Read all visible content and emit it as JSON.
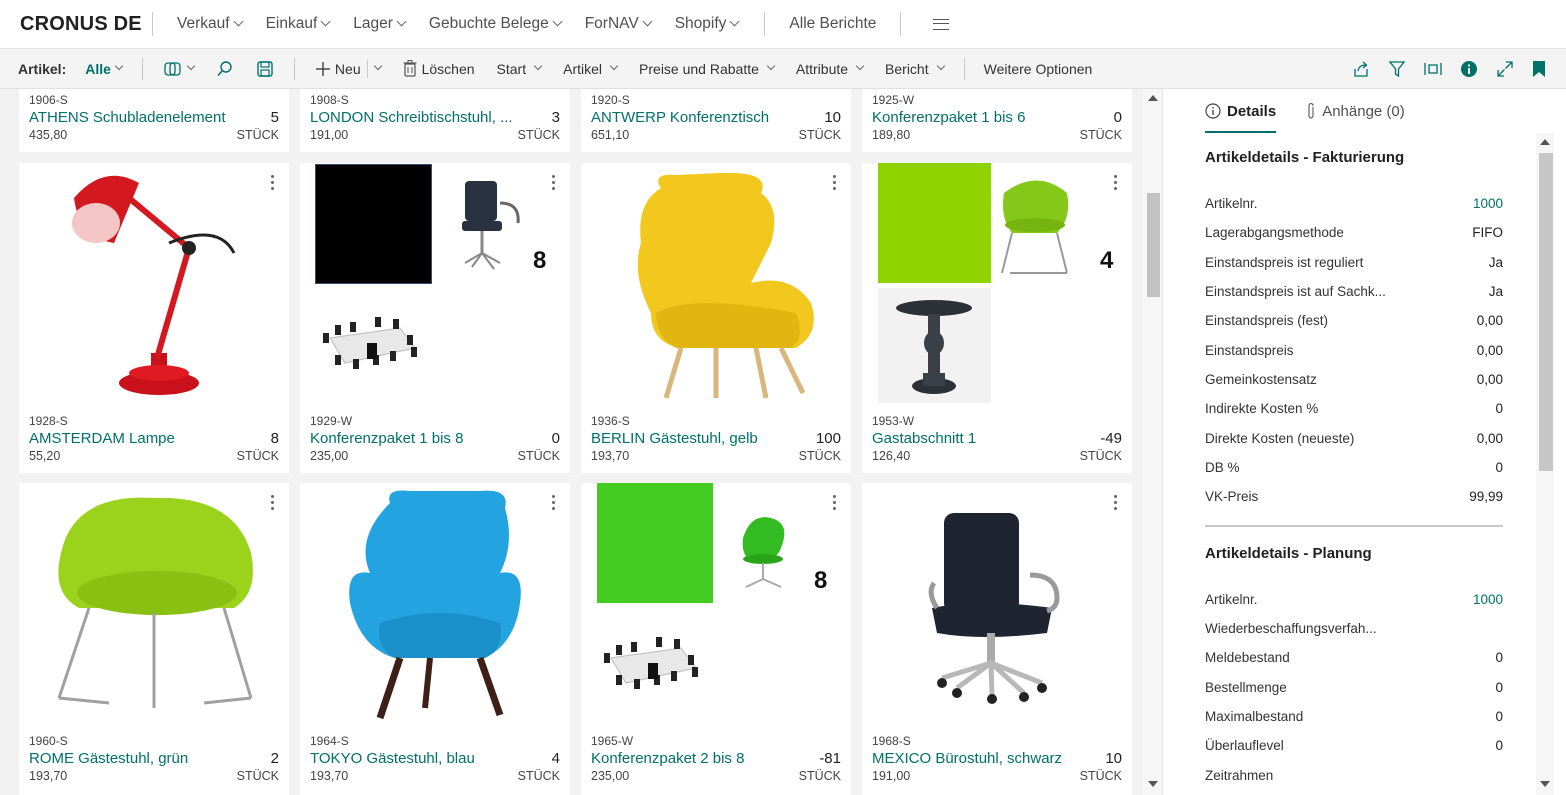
{
  "app": {
    "company": "CRONUS DE"
  },
  "nav": {
    "items": [
      "Verkauf",
      "Einkauf",
      "Lager",
      "Gebuchte Belege",
      "ForNAV",
      "Shopify"
    ],
    "reports": "Alle Berichte"
  },
  "actionbar": {
    "label": "Artikel:",
    "filter": "Alle",
    "new": "Neu",
    "delete": "Löschen",
    "start": "Start",
    "artikel": "Artikel",
    "prices": "Preise und Rabatte",
    "attributes": "Attribute",
    "report": "Bericht",
    "more": "Weitere Optionen"
  },
  "tiles": [
    {
      "code": "1906-S",
      "name": "ATHENS Schubladenelement",
      "qty": "5",
      "price": "435,80",
      "unit": "STÜCK"
    },
    {
      "code": "1908-S",
      "name": "LONDON Schreibtischstuhl, ...",
      "qty": "3",
      "price": "191,00",
      "unit": "STÜCK"
    },
    {
      "code": "1920-S",
      "name": "ANTWERP Konferenztisch",
      "qty": "10",
      "price": "651,10",
      "unit": "STÜCK"
    },
    {
      "code": "1925-W",
      "name": "Konferenzpaket 1 bis 6",
      "qty": "0",
      "price": "189,80",
      "unit": "STÜCK"
    },
    {
      "code": "1928-S",
      "name": "AMSTERDAM Lampe",
      "qty": "8",
      "price": "55,20",
      "unit": "STÜCK"
    },
    {
      "code": "1929-W",
      "name": "Konferenzpaket 1 bis 8",
      "qty": "0",
      "price": "235,00",
      "unit": "STÜCK",
      "badge": "8"
    },
    {
      "code": "1936-S",
      "name": "BERLIN Gästestuhl, gelb",
      "qty": "100",
      "price": "193,70",
      "unit": "STÜCK"
    },
    {
      "code": "1953-W",
      "name": "Gastabschnitt 1",
      "qty": "-49",
      "price": "126,40",
      "unit": "STÜCK",
      "badge": "4"
    },
    {
      "code": "1960-S",
      "name": "ROME Gästestuhl, grün",
      "qty": "2",
      "price": "193,70",
      "unit": "STÜCK"
    },
    {
      "code": "1964-S",
      "name": "TOKYO Gästestuhl, blau",
      "qty": "4",
      "price": "193,70",
      "unit": "STÜCK"
    },
    {
      "code": "1965-W",
      "name": "Konferenzpaket 2 bis 8",
      "qty": "-81",
      "price": "235,00",
      "unit": "STÜCK",
      "badge": "8"
    },
    {
      "code": "1968-S",
      "name": "MEXICO Bürostuhl, schwarz",
      "qty": "10",
      "price": "191,00",
      "unit": "STÜCK"
    }
  ],
  "factbox": {
    "tabs": {
      "details": "Details",
      "attachments": "Anhänge (0)"
    },
    "section1": {
      "title": "Artikeldetails - Fakturierung",
      "rows": [
        {
          "label": "Artikelnr.",
          "value": "1000"
        },
        {
          "label": "Lagerabgangsmethode",
          "value": "FIFO"
        },
        {
          "label": "Einstandspreis ist reguliert",
          "value": "Ja"
        },
        {
          "label": "Einstandspreis ist auf Sachk...",
          "value": "Ja"
        },
        {
          "label": "Einstandspreis (fest)",
          "value": "0,00"
        },
        {
          "label": "Einstandspreis",
          "value": "0,00"
        },
        {
          "label": "Gemeinkostensatz",
          "value": "0,00"
        },
        {
          "label": "Indirekte Kosten %",
          "value": "0"
        },
        {
          "label": "Direkte Kosten (neueste)",
          "value": "0,00"
        },
        {
          "label": "DB %",
          "value": "0"
        },
        {
          "label": "VK-Preis",
          "value": "99,99"
        }
      ]
    },
    "section2": {
      "title": "Artikeldetails - Planung",
      "rows": [
        {
          "label": "Artikelnr.",
          "value": "1000"
        },
        {
          "label": "Wiederbeschaffungsverfah...",
          "value": ""
        },
        {
          "label": "Meldebestand",
          "value": "0"
        },
        {
          "label": "Bestellmenge",
          "value": "0"
        },
        {
          "label": "Maximalbestand",
          "value": "0"
        },
        {
          "label": "Überlauflevel",
          "value": "0"
        },
        {
          "label": "Zeitrahmen",
          "value": ""
        }
      ]
    }
  },
  "colors": {
    "accent": "#00706b",
    "green_swatch_1": "#8fd400",
    "green_swatch_2": "#44cc22"
  }
}
